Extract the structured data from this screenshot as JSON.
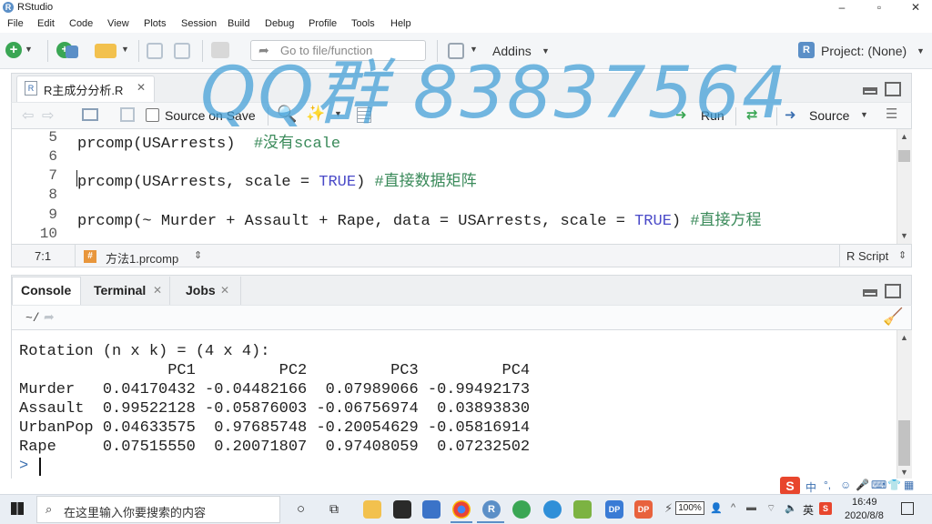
{
  "window": {
    "title": "RStudio",
    "controls": {
      "minimize": "–",
      "maximize": "▫",
      "close": "✕"
    }
  },
  "menu": [
    "File",
    "Edit",
    "Code",
    "View",
    "Plots",
    "Session",
    "Build",
    "Debug",
    "Profile",
    "Tools",
    "Help"
  ],
  "toolbar": {
    "goto_placeholder": "Go to file/function",
    "addins_label": "Addins",
    "project_label": "Project: (None)"
  },
  "editor": {
    "tab_label": "R主成分分析.R",
    "source_on_save_label": "Source on Save",
    "run_label": "Run",
    "source_label": "Source",
    "lines": [
      {
        "num": "5",
        "code": "prcomp(USArrests)  ",
        "comment": "#没有scale"
      },
      {
        "num": "6",
        "code": "",
        "comment": ""
      },
      {
        "num": "7",
        "code_a": "prcomp(USArrests, scale = ",
        "kw": "TRUE",
        "code_b": ") ",
        "comment": "#直接数据矩阵"
      },
      {
        "num": "8",
        "code": "",
        "comment": ""
      },
      {
        "num": "9",
        "code_a": "prcomp(~ Murder + Assault + Rape, data = USArrests, scale = ",
        "kw": "TRUE",
        "code_b": ") ",
        "comment": "#直接方程"
      },
      {
        "num": "10",
        "code": "",
        "comment": ""
      }
    ],
    "status": {
      "position": "7:1",
      "function": "方法1.prcomp",
      "filetype": "R Script"
    }
  },
  "console": {
    "tabs": [
      "Console",
      "Terminal",
      "Jobs"
    ],
    "path": "~/",
    "output": [
      "Rotation (n x k) = (4 x 4):",
      "                PC1         PC2         PC3         PC4",
      "Murder   0.04170432 -0.04482166  0.07989066 -0.99492173",
      "Assault  0.99522128 -0.05876003 -0.06756974  0.03893830",
      "UrbanPop 0.04633575  0.97685748 -0.20054629 -0.05816914",
      "Rape     0.07515550  0.20071807  0.97408059  0.07232502"
    ],
    "prompt": ">"
  },
  "taskbar": {
    "search_placeholder": "在这里输入你要搜索的内容",
    "battery": "100%",
    "ime": "中",
    "ime_mode": "英",
    "time": "16:49",
    "date": "2020/8/8"
  },
  "watermark": "QQ群 83837564",
  "colors": {
    "accent": "#4a8fd3",
    "comment": "#3a8a5a",
    "keyword": "#4a4ac8",
    "watermark": "#3e9cd6"
  }
}
